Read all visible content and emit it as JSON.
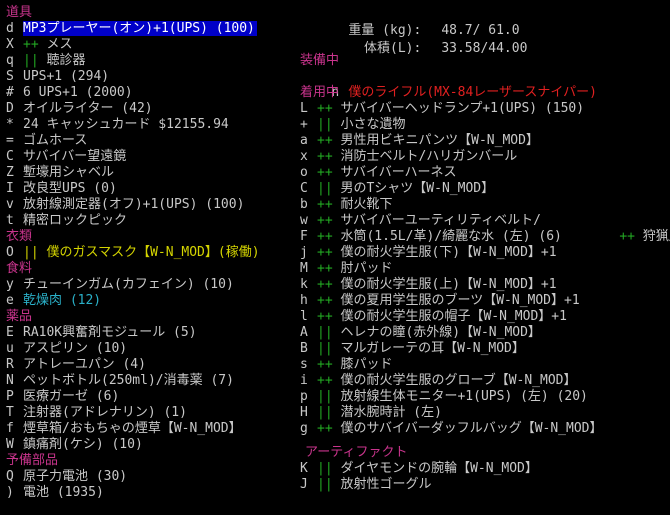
{
  "left": {
    "category_tools": "道具",
    "tools": [
      {
        "key": "d",
        "mark": "",
        "name": "MP3プレーヤー(オン)+1(UPS) (100)",
        "selected": true
      },
      {
        "key": "X",
        "mark": "++",
        "name": " メス"
      },
      {
        "key": "q",
        "mark": "||",
        "name": " 聴診器"
      },
      {
        "key": "S",
        "mark": "",
        "name": "UPS+1 (294)"
      },
      {
        "key": "#",
        "mark": "",
        "name": "6 UPS+1 (2000)"
      },
      {
        "key": "D",
        "mark": "",
        "name": "オイルライター (42)"
      },
      {
        "key": "*",
        "mark": "",
        "name": "24 キャッシュカード $12155.94"
      },
      {
        "key": "=",
        "mark": "",
        "name": "ゴムホース"
      },
      {
        "key": "C",
        "mark": "",
        "name": "サバイバー望遠鏡"
      },
      {
        "key": "Z",
        "mark": "",
        "name": "塹壕用シャベル"
      },
      {
        "key": "I",
        "mark": "",
        "name": "改良型UPS (0)"
      },
      {
        "key": "v",
        "mark": "",
        "name": "放射線測定器(オフ)+1(UPS) (100)"
      },
      {
        "key": "t",
        "mark": "",
        "name": "精密ロックピック"
      }
    ],
    "category_clothing": "衣類",
    "clothing": [
      {
        "key": "O",
        "mark": "||",
        "name": " 僕のガスマスク【W-N_MOD】(稼働)"
      }
    ],
    "category_food": "食料",
    "food": [
      {
        "key": "y",
        "mark": "",
        "name": "チューインガム(カフェイン) (10)"
      },
      {
        "key": "e",
        "mark": "",
        "name": "乾燥肉 (12)"
      }
    ],
    "category_medicine": "薬品",
    "medicine": [
      {
        "key": "E",
        "mark": "",
        "name": "RA10K興奮剤モジュール (5)"
      },
      {
        "key": "u",
        "mark": "",
        "name": "アスピリン (10)"
      },
      {
        "key": "R",
        "mark": "",
        "name": "アトレーユパン (4)"
      },
      {
        "key": "N",
        "mark": "",
        "name": "ペットボトル(250ml)/消毒薬 (7)"
      },
      {
        "key": "P",
        "mark": "",
        "name": "医療ガーゼ (6)"
      },
      {
        "key": "T",
        "mark": "",
        "name": "注射器(アドレナリン) (1)"
      },
      {
        "key": "f",
        "mark": "",
        "name": "煙草箱/おもちゃの煙草【W-N_MOD】"
      },
      {
        "key": "W",
        "mark": "",
        "name": "鎮痛剤(ケシ) (10)"
      }
    ],
    "category_spare": "予備部品",
    "spare": [
      {
        "key": "Q",
        "mark": "",
        "name": "原子力電池 (30)"
      },
      {
        "key": ")",
        "mark": "",
        "name": "電池 (1935)"
      }
    ]
  },
  "right": {
    "weight_label": "重量 (kg):",
    "weight_value": "48.7/ 61.0",
    "volume_label": "体積(L):",
    "volume_value": "33.58/44.00",
    "category_wielded": "装備中",
    "wielded_key": "n",
    "wielded_name": "僕のライフル(MX-84レーザースナイパー)",
    "category_worn": "着用中",
    "worn": [
      {
        "key": "L",
        "mark": "++",
        "name": " サバイバーヘッドランプ+1(UPS) (150)"
      },
      {
        "key": "+",
        "mark": "||",
        "name": " 小さな遺物"
      },
      {
        "key": "a",
        "mark": "++",
        "name": " 男性用ビキニパンツ【W-N_MOD】"
      },
      {
        "key": "x",
        "mark": "++",
        "name": " 消防士ベルト/ハリガンバール"
      },
      {
        "key": "o",
        "mark": "++",
        "name": " サバイバーハーネス"
      },
      {
        "key": "C",
        "mark": "||",
        "name": " 男のTシャツ【W-N_MOD】"
      },
      {
        "key": "b",
        "mark": "++",
        "name": " 耐火靴下"
      },
      {
        "key": "w",
        "mark": "++",
        "name": " サバイバーユーティリティベルト/"
      },
      {
        "key": "F",
        "mark": "++",
        "name": " 水筒(1.5L/革)/綺麗な水 (左) (6)"
      },
      {
        "key": "j",
        "mark": "++",
        "name": " 僕の耐火学生服(下)【W-N_MOD】+1"
      },
      {
        "key": "M",
        "mark": "++",
        "name": " 肘パッド"
      },
      {
        "key": "k",
        "mark": "++",
        "name": " 僕の耐火学生服(上)【W-N_MOD】+1"
      },
      {
        "key": "h",
        "mark": "++",
        "name": " 僕の夏用学生服のブーツ【W-N_MOD】+1"
      },
      {
        "key": "l",
        "mark": "++",
        "name": " 僕の耐火学生服の帽子【W-N_MOD】+1"
      },
      {
        "key": "A",
        "mark": "||",
        "name": " ヘレナの瞳(赤外線)【W-N_MOD】"
      },
      {
        "key": "B",
        "mark": "||",
        "name": " マルガレーテの耳【W-N_MOD】"
      },
      {
        "key": "s",
        "mark": "++",
        "name": " 膝パッド"
      },
      {
        "key": "i",
        "mark": "++",
        "name": " 僕の耐火学生服のグローブ【W-N_MOD】"
      },
      {
        "key": "p",
        "mark": "||",
        "name": " 放射線生体モニター+1(UPS) (左) (20)"
      },
      {
        "key": "H",
        "mark": "||",
        "name": " 潜水腕時計 (左)"
      },
      {
        "key": "g",
        "mark": "++",
        "name": " 僕のサバイバーダッフルバッグ【W-N_MOD】"
      }
    ],
    "belt_overflow_mark": "++",
    "belt_overflow_text": " 狩猟用ナ",
    "category_artifact": "アーティファクト",
    "artifacts": [
      {
        "key": "K",
        "mark": "||",
        "name": " ダイヤモンドの腕輪【W-N_MOD】"
      },
      {
        "key": "J",
        "mark": "||",
        "name": " 放射性ゴーグル"
      }
    ]
  }
}
